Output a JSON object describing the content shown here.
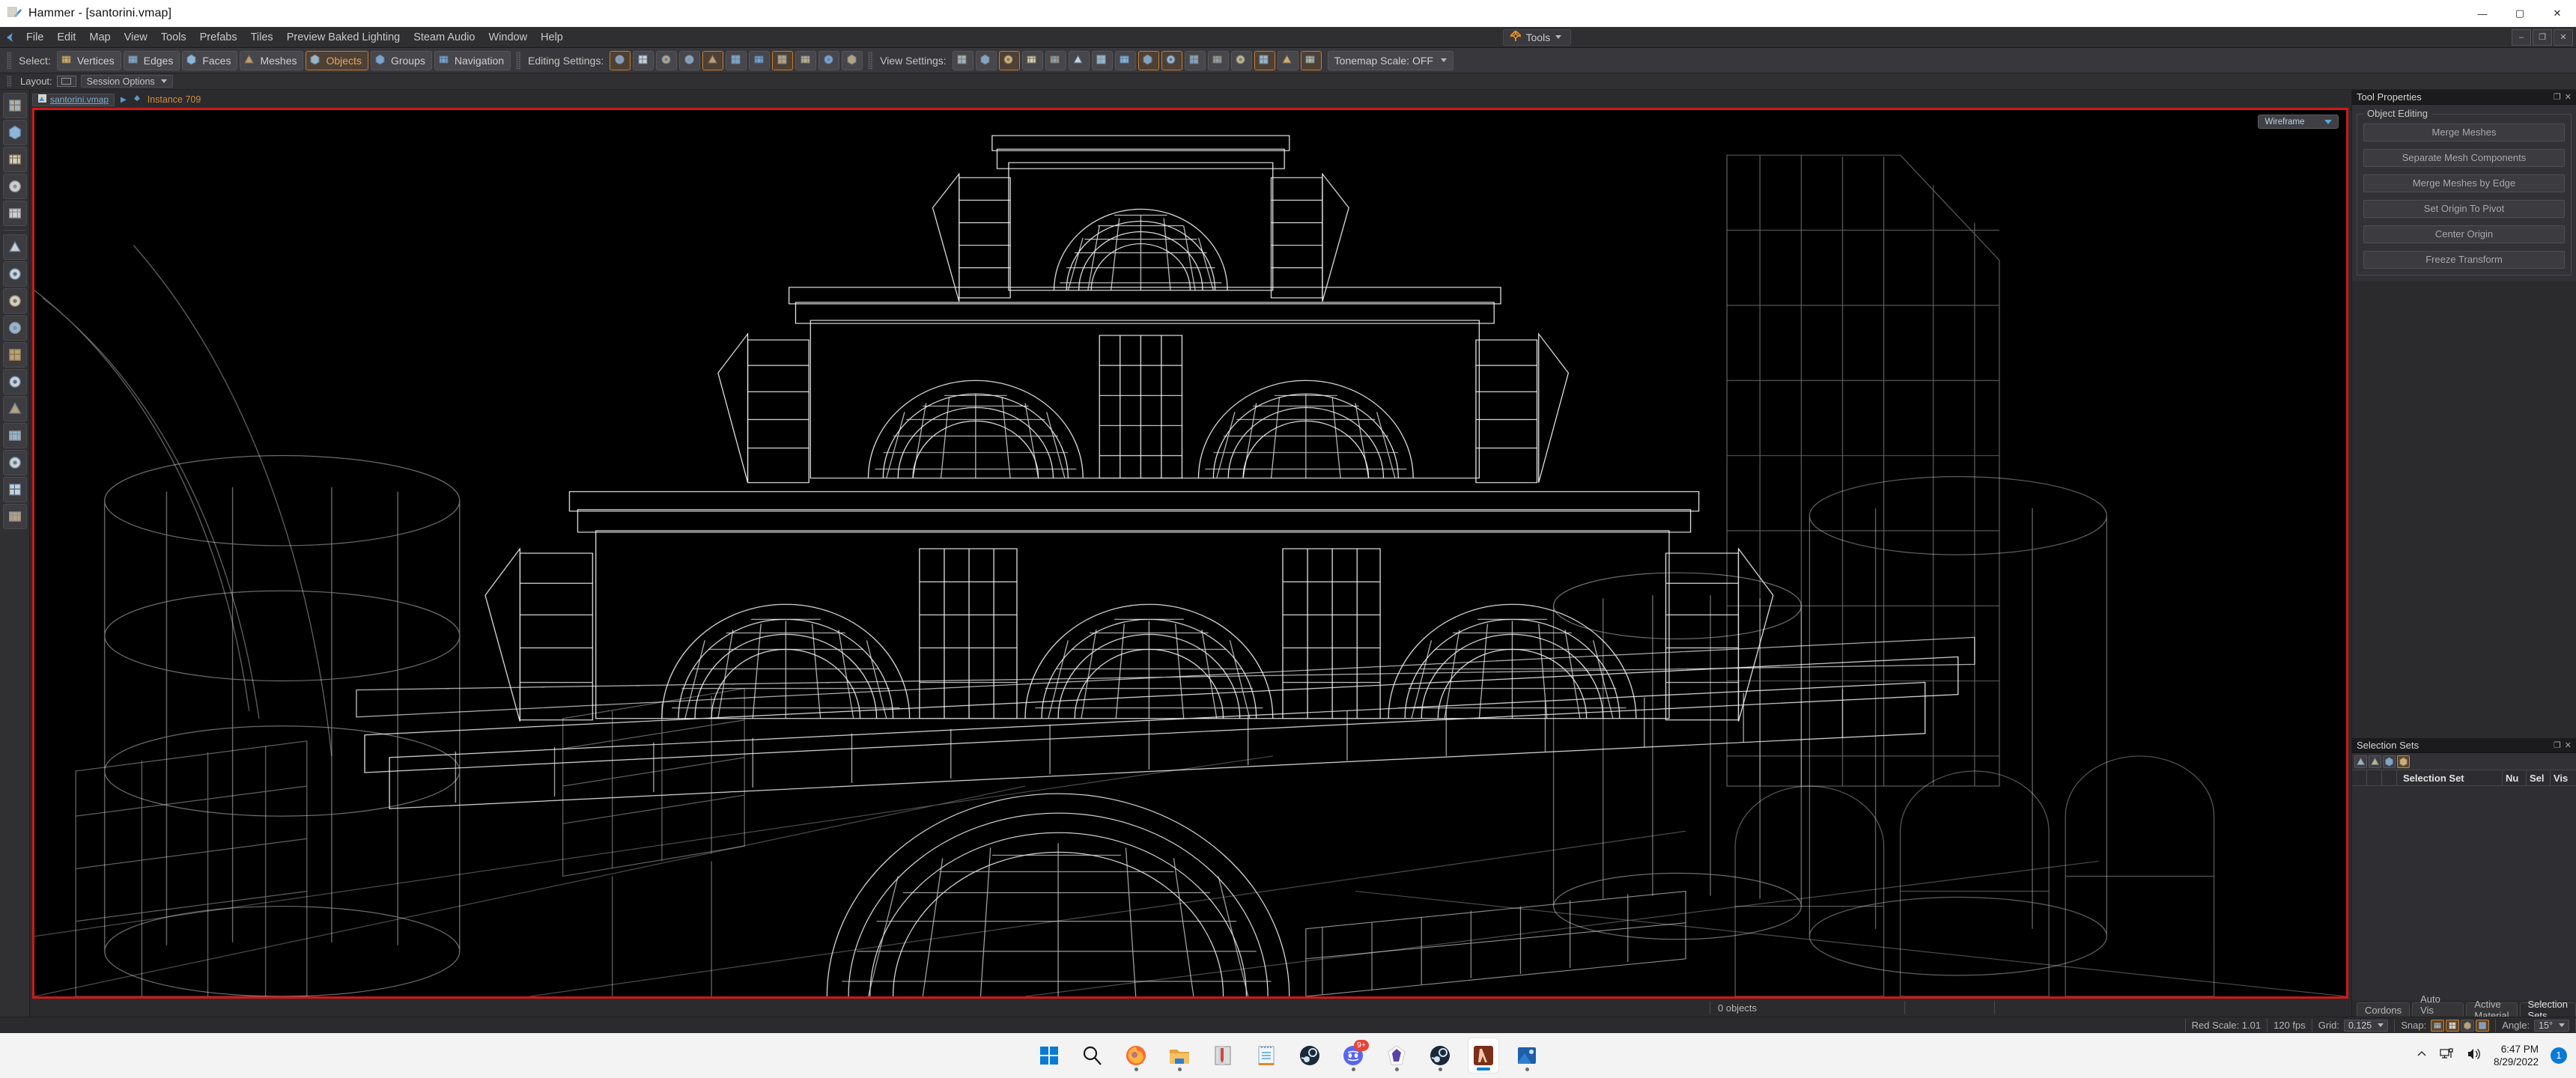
{
  "window": {
    "title": "Hammer - [santorini.vmap]",
    "app_icon": "hammer-icon",
    "minimize": "—",
    "maximize": "▢",
    "close": "✕"
  },
  "menubar": {
    "logo": "valve-arrow-icon",
    "items": [
      "File",
      "Edit",
      "Map",
      "View",
      "Tools",
      "Prefabs",
      "Tiles",
      "Preview Baked Lighting",
      "Steam Audio",
      "Window",
      "Help"
    ],
    "tools_button": {
      "label": "Tools",
      "icon": "gear-icon"
    },
    "window_controls": [
      "—",
      "❐",
      "✕"
    ]
  },
  "toolbar": {
    "select_label": "Select:",
    "select_modes": [
      {
        "label": "Vertices",
        "icon": "vertices-icon",
        "active": false
      },
      {
        "label": "Edges",
        "icon": "edges-icon",
        "active": false
      },
      {
        "label": "Faces",
        "icon": "faces-icon",
        "active": false
      },
      {
        "label": "Meshes",
        "icon": "meshes-icon",
        "active": false
      },
      {
        "label": "Objects",
        "icon": "objects-icon",
        "active": true
      },
      {
        "label": "Groups",
        "icon": "groups-icon",
        "active": false
      },
      {
        "label": "Navigation",
        "icon": "navigation-icon",
        "active": false
      }
    ],
    "editing_label": "Editing Settings:",
    "editing_icons": [
      {
        "name": "world-align-icon",
        "active": true
      },
      {
        "name": "local-axis-icon",
        "active": false
      },
      {
        "name": "grid-snap-icon",
        "active": false
      },
      {
        "name": "sphere-snap-icon",
        "active": false
      },
      {
        "name": "texture-lock-icon",
        "active": true
      },
      {
        "name": "texture-scale-lock-icon",
        "active": false
      },
      {
        "name": "vertex-lock-icon",
        "active": false
      },
      {
        "name": "entity-lock-icon",
        "active": true
      },
      {
        "name": "instance-lock-icon",
        "active": false
      },
      {
        "name": "light-lock-icon",
        "active": false
      },
      {
        "name": "gamepad-icon",
        "active": false
      }
    ],
    "view_label": "View Settings:",
    "view_icons": [
      {
        "name": "shading-icon",
        "active": false
      },
      {
        "name": "paint-icon",
        "active": false
      },
      {
        "name": "tint-icon",
        "active": true
      },
      {
        "name": "lights-icon",
        "active": false
      },
      {
        "name": "fog-icon",
        "active": false
      },
      {
        "name": "nav-markers-icon",
        "active": false
      },
      {
        "name": "solid-shading-icon",
        "active": false
      },
      {
        "name": "shadow-icon",
        "active": false
      },
      {
        "name": "wireframe-icon",
        "active": true
      },
      {
        "name": "ruler-icon",
        "active": true
      },
      {
        "name": "measure-icon",
        "active": false
      },
      {
        "name": "player-clip-icon",
        "active": false
      },
      {
        "name": "flame-icon",
        "active": false
      },
      {
        "name": "flame-blue-icon",
        "active": true
      },
      {
        "name": "foliage-icon",
        "active": false
      },
      {
        "name": "sound-icon",
        "active": true
      }
    ],
    "tonemap": {
      "label": "Tonemap Scale: OFF",
      "caret": "▾"
    }
  },
  "layoutbar": {
    "label": "Layout:",
    "swatch": "single-pane-layout-icon",
    "session_options": {
      "label": "Session Options",
      "caret": "▾"
    }
  },
  "breadcrumb": {
    "root": {
      "label": "santorini.vmap",
      "icon": "vmap-file-icon"
    },
    "separator": "▶",
    "current": {
      "label": "Instance 709",
      "icon": "instance-icon"
    }
  },
  "lefttoolbar": {
    "tools": [
      {
        "name": "select-tool",
        "icon": "arrow-cursor-icon"
      },
      {
        "name": "translate-tool",
        "icon": "move-arrows-icon"
      },
      {
        "name": "rotate-tool",
        "icon": "rotate-arrow-icon"
      },
      {
        "name": "scale-tool",
        "icon": "scale-corners-icon"
      },
      {
        "name": "pivot-tool",
        "icon": "pivot-circle-icon"
      },
      {
        "name": "entity-tool",
        "icon": "lightbulb-icon"
      },
      {
        "name": "block-tool",
        "icon": "block-cube-icon"
      },
      {
        "name": "path-tool",
        "icon": "path-curve-icon"
      },
      {
        "name": "polygon-tool",
        "icon": "polygon-shape-icon"
      },
      {
        "name": "clip-tool",
        "icon": "clip-blade-icon"
      },
      {
        "name": "mirror-tool",
        "icon": "mirror-icon"
      },
      {
        "name": "material-tool",
        "icon": "checker-material-icon"
      },
      {
        "name": "paint-tool",
        "icon": "paint-spray-icon"
      },
      {
        "name": "displacement-tool",
        "icon": "displacement-mesh-icon"
      },
      {
        "name": "tile-tool",
        "icon": "tile-blocks-icon"
      },
      {
        "name": "foliage-tool",
        "icon": "sprout-icon"
      }
    ]
  },
  "viewport": {
    "render_mode": {
      "label": "Wireframe",
      "caret": "▾"
    },
    "object_count": "0 objects",
    "focused": true,
    "focus_border_color": "#d01818",
    "background_color": "#000000",
    "wire_color": "#ffffff"
  },
  "tool_properties": {
    "title": "Tool Properties",
    "actions": [
      "❐",
      "✕"
    ],
    "group_title": "Object Editing",
    "buttons": [
      "Merge Meshes",
      "Separate Mesh Components",
      "Merge Meshes by Edge",
      "Set Origin To Pivot",
      "Center Origin",
      "Freeze Transform"
    ]
  },
  "selection_sets": {
    "title": "Selection Sets",
    "actions": [
      "❐",
      "✕"
    ],
    "toolbar_icons": [
      {
        "name": "globe-set-icon",
        "active": false
      },
      {
        "name": "tree-set-icon",
        "active": false
      },
      {
        "name": "nodes-set-icon",
        "active": false
      },
      {
        "name": "grid-set-icon",
        "active": true
      }
    ],
    "columns": [
      "",
      "",
      "",
      "Selection Set",
      "Nu",
      "Sel",
      "Vis"
    ],
    "rows": []
  },
  "dock_tabs": [
    {
      "label": "Cordons",
      "active": false
    },
    {
      "label": "Auto Vis Groups",
      "active": false
    },
    {
      "label": "Active Material",
      "active": false
    },
    {
      "label": "Selection Sets",
      "active": true
    }
  ],
  "statusbar": {
    "red_scale": "Red Scale: 1.01",
    "fps": "120 fps",
    "grid_label": "Grid:",
    "grid_value": "0.125",
    "snap_label": "Snap:",
    "snap_icons": [
      {
        "name": "snap-curve-icon",
        "active": true
      },
      {
        "name": "snap-grid-icon",
        "active": true
      },
      {
        "name": "snap-magnet-icon",
        "active": false
      },
      {
        "name": "snap-surface-icon",
        "active": true
      }
    ],
    "angle_label": "Angle:",
    "angle_value": "15°",
    "caret": "▾"
  },
  "taskbar": {
    "apps": [
      {
        "name": "start-button-icon",
        "label": "Start",
        "state": "idle"
      },
      {
        "name": "search-icon",
        "label": "Search",
        "state": "idle"
      },
      {
        "name": "firefox-icon",
        "label": "Firefox",
        "state": "running"
      },
      {
        "name": "file-explorer-icon",
        "label": "File Explorer",
        "state": "running"
      },
      {
        "name": "winrar-icon",
        "label": "WinRAR",
        "state": "idle"
      },
      {
        "name": "notepad-icon",
        "label": "Notepad",
        "state": "idle"
      },
      {
        "name": "steam-icon",
        "label": "Steam",
        "state": "idle"
      },
      {
        "name": "discord-icon",
        "label": "Discord",
        "state": "running",
        "badge": "9+"
      },
      {
        "name": "obsidian-icon",
        "label": "Obsidian",
        "state": "running"
      },
      {
        "name": "steam-alt-icon",
        "label": "Steam",
        "state": "running"
      },
      {
        "name": "halflife-hammer-icon",
        "label": "Hammer",
        "state": "active"
      },
      {
        "name": "photos-icon",
        "label": "Photos",
        "state": "running"
      }
    ],
    "tray": {
      "chevron": "show-hidden-icons",
      "network": "network-icon",
      "volume": "volume-icon",
      "time": "6:47 PM",
      "date": "8/29/2022",
      "notification_count": "1"
    }
  }
}
